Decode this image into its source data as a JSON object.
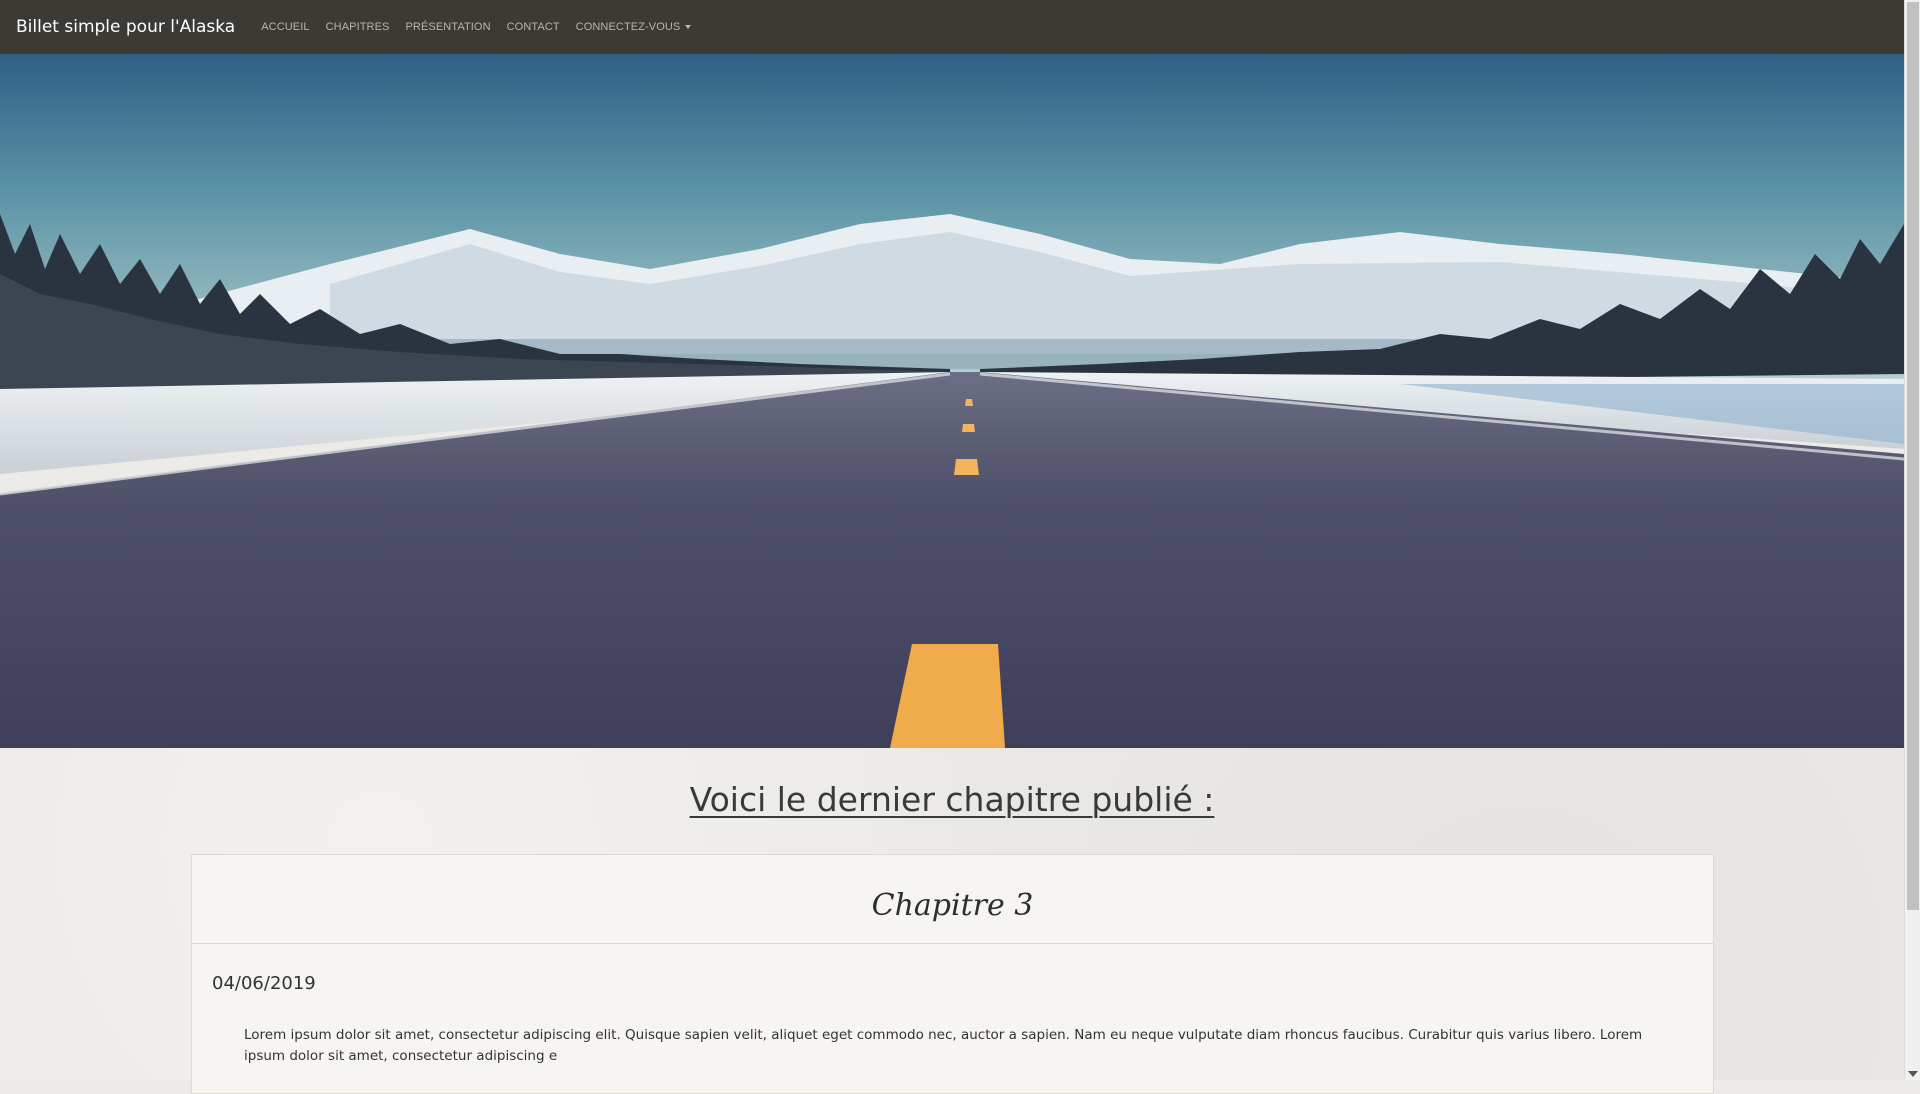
{
  "navbar": {
    "brand": "Billet simple pour l'Alaska",
    "items": [
      {
        "label": "ACCUEIL"
      },
      {
        "label": "CHAPITRES"
      },
      {
        "label": "PRÉSENTATION"
      },
      {
        "label": "CONTACT"
      },
      {
        "label": "CONNECTEZ-VOUS",
        "has_dropdown": true
      }
    ]
  },
  "hero": {
    "image": "alaska-road-landscape"
  },
  "main": {
    "section_title": "Voici le dernier chapitre publié :",
    "chapter": {
      "title": "Chapitre 3",
      "date": "04/06/2019",
      "excerpt": "Lorem ipsum dolor sit amet, consectetur adipiscing elit. Quisque sapien velit, aliquet eget commodo nec, auctor a sapien. Nam eu neque vulputate diam rhoncus faucibus. Curabitur quis varius libero. Lorem ipsum dolor sit amet, consectetur adipiscing e"
    }
  },
  "colors": {
    "navbar_bg": "#3b3a35",
    "nav_text": "#b7b5ae",
    "page_bg": "#eceae6",
    "card_bg": "#f7f5f1"
  }
}
